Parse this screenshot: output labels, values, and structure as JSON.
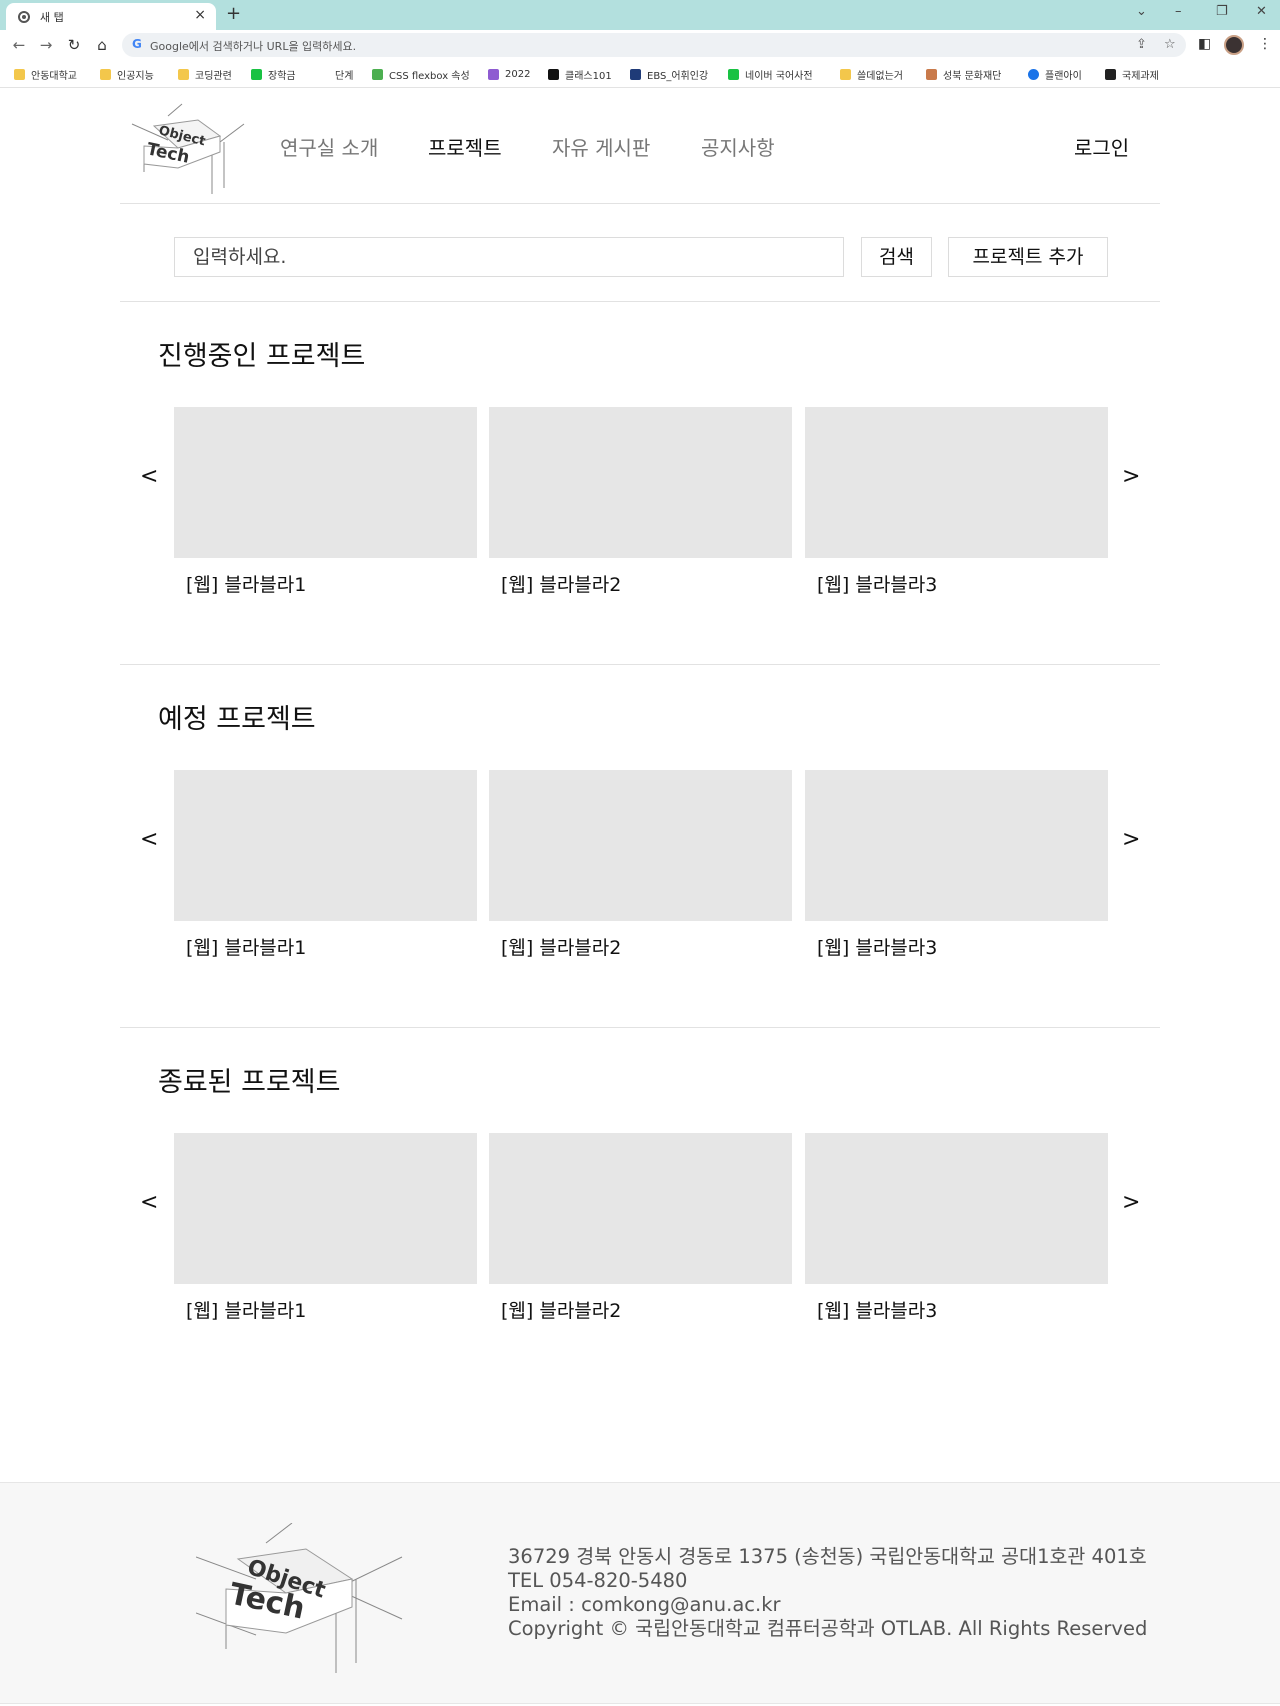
{
  "browser": {
    "tab_title": "새 탭",
    "tab_close": "×",
    "new_tab": "+",
    "omnibox_placeholder": "Google에서 검색하거나 URL을 입력하세요.",
    "bookmarks": [
      {
        "label": "안동대학교",
        "icon": "folder-icon"
      },
      {
        "label": "인공지능",
        "icon": "folder-icon"
      },
      {
        "label": "코딩관련",
        "icon": "folder-icon"
      },
      {
        "label": "장학금",
        "icon": "naver-icon"
      },
      {
        "label": "단계",
        "icon": "code-icon"
      },
      {
        "label": "CSS flexbox 속성",
        "icon": "frog-icon"
      },
      {
        "label": "2022",
        "icon": "devil-icon"
      },
      {
        "label": "클래스101",
        "icon": "class101-icon"
      },
      {
        "label": "EBS_어휘인강",
        "icon": "ebs-icon"
      },
      {
        "label": "네이버 국어사전",
        "icon": "dict-icon"
      },
      {
        "label": "쓸데없는거",
        "icon": "folder-icon"
      },
      {
        "label": "성북 문화재단",
        "icon": "culture-icon"
      },
      {
        "label": "플랜아이",
        "icon": "info-icon"
      },
      {
        "label": "국제과제",
        "icon": "notion-icon"
      }
    ]
  },
  "header": {
    "logo_text_top": "Object",
    "logo_text_bottom": "Tech",
    "nav": [
      "연구실 소개",
      "프로젝트",
      "자유 게시판",
      "공지사항"
    ],
    "active_nav": "프로젝트",
    "login": "로그인"
  },
  "search": {
    "placeholder": "입력하세요.",
    "search_button": "검색",
    "add_button": "프로젝트 추가"
  },
  "sections": [
    {
      "title": "진행중인 프로젝트",
      "prev": "<",
      "next": ">",
      "cards": [
        "[웹] 블라블라1",
        "[웹] 블라블라2",
        "[웹] 블라블라3"
      ]
    },
    {
      "title": "예정 프로젝트",
      "prev": "<",
      "next": ">",
      "cards": [
        "[웹] 블라블라1",
        "[웹] 블라블라2",
        "[웹] 블라블라3"
      ]
    },
    {
      "title": "종료된 프로젝트",
      "prev": "<",
      "next": ">",
      "cards": [
        "[웹] 블라블라1",
        "[웹] 블라블라2",
        "[웹] 블라블라3"
      ]
    }
  ],
  "footer": {
    "address": "36729 경북 안동시 경동로 1375 (송천동) 국립안동대학교 공대1호관 401호",
    "tel": "TEL 054-820-5480",
    "email": "Email : comkong@anu.ac.kr",
    "copyright": "Copyright © 국립안동대학교 컴퓨터공학과 OTLAB. All Rights Reserved"
  },
  "colors": {
    "tabbar": "#b3e0de",
    "placeholder_card": "#e6e6e6",
    "footer_bg": "#f7f7f7"
  }
}
